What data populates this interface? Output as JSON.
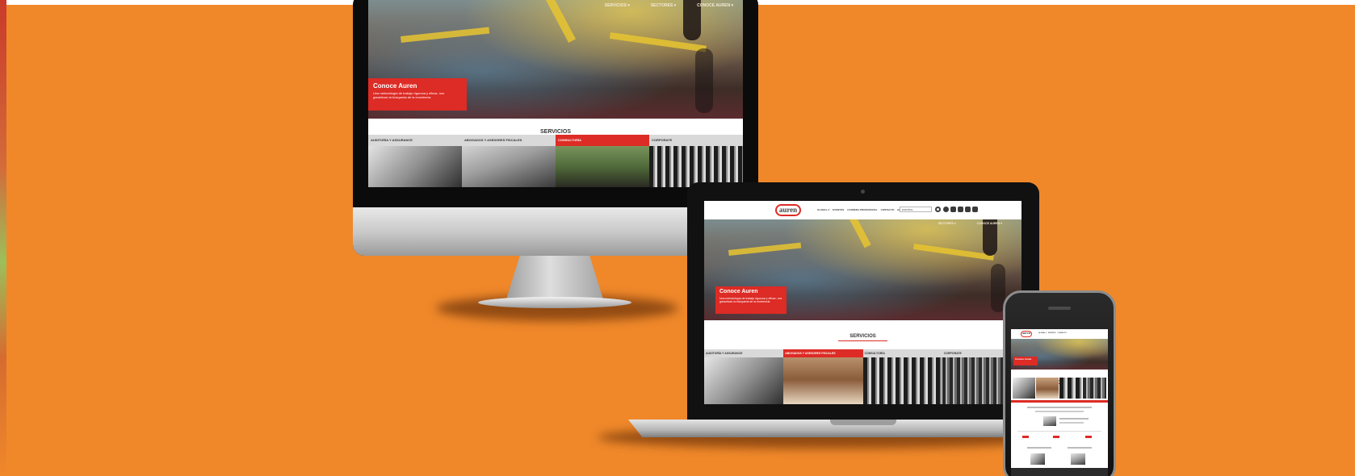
{
  "site": {
    "brand": "auren",
    "hero": {
      "nav": [
        "SERVICIOS ▾",
        "SECTORES ▾",
        "CONOCE AUREN ▾"
      ],
      "heading": "Conoce Auren",
      "text": "Una metodología de trabajo rigurosa y eficaz, nos garantizan la búsqueda de la excelencia"
    },
    "header_nav": [
      "GLOBAL ▾",
      "EVENTOS",
      "CARRERA PROFESIONAL",
      "CONTACTO",
      "EN ▾"
    ],
    "language": "ESPAÑOL",
    "services": {
      "title": "SERVICIOS",
      "tiles": [
        "AUDITORÍA Y ASSURANCE",
        "ABOGADOS Y ASESORES FISCALES",
        "CONSULTORÍA",
        "CORPORATE"
      ]
    }
  },
  "colors": {
    "background": "#f0882a",
    "brand_red": "#dd2b25"
  }
}
